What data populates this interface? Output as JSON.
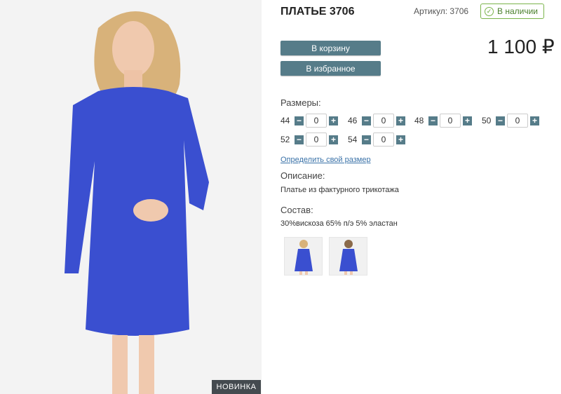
{
  "product": {
    "title": "ПЛАТЬЕ 3706",
    "article": "Артикул: 3706",
    "stock_label": "В наличии",
    "price": "1 100 ₽",
    "badge": "НОВИНКА"
  },
  "buttons": {
    "cart": "В корзину",
    "favorite": "В избранное"
  },
  "sizes": {
    "label": "Размеры:",
    "items": [
      {
        "size": "44",
        "qty": "0"
      },
      {
        "size": "46",
        "qty": "0"
      },
      {
        "size": "48",
        "qty": "0"
      },
      {
        "size": "50",
        "qty": "0"
      },
      {
        "size": "52",
        "qty": "0"
      },
      {
        "size": "54",
        "qty": "0"
      }
    ],
    "minus": "−",
    "plus": "+"
  },
  "size_link": "Определить свой размер",
  "description": {
    "label": "Описание:",
    "text": "Платье из фактурного трикотажа"
  },
  "composition": {
    "label": "Состав:",
    "text": "30%вискоза 65% п/э 5% эластан"
  },
  "colors": {
    "dress": "#3a4fd0",
    "accent": "#567c89",
    "stock": "#7bb44b"
  },
  "icons": {
    "stock": "check-circle-icon"
  }
}
